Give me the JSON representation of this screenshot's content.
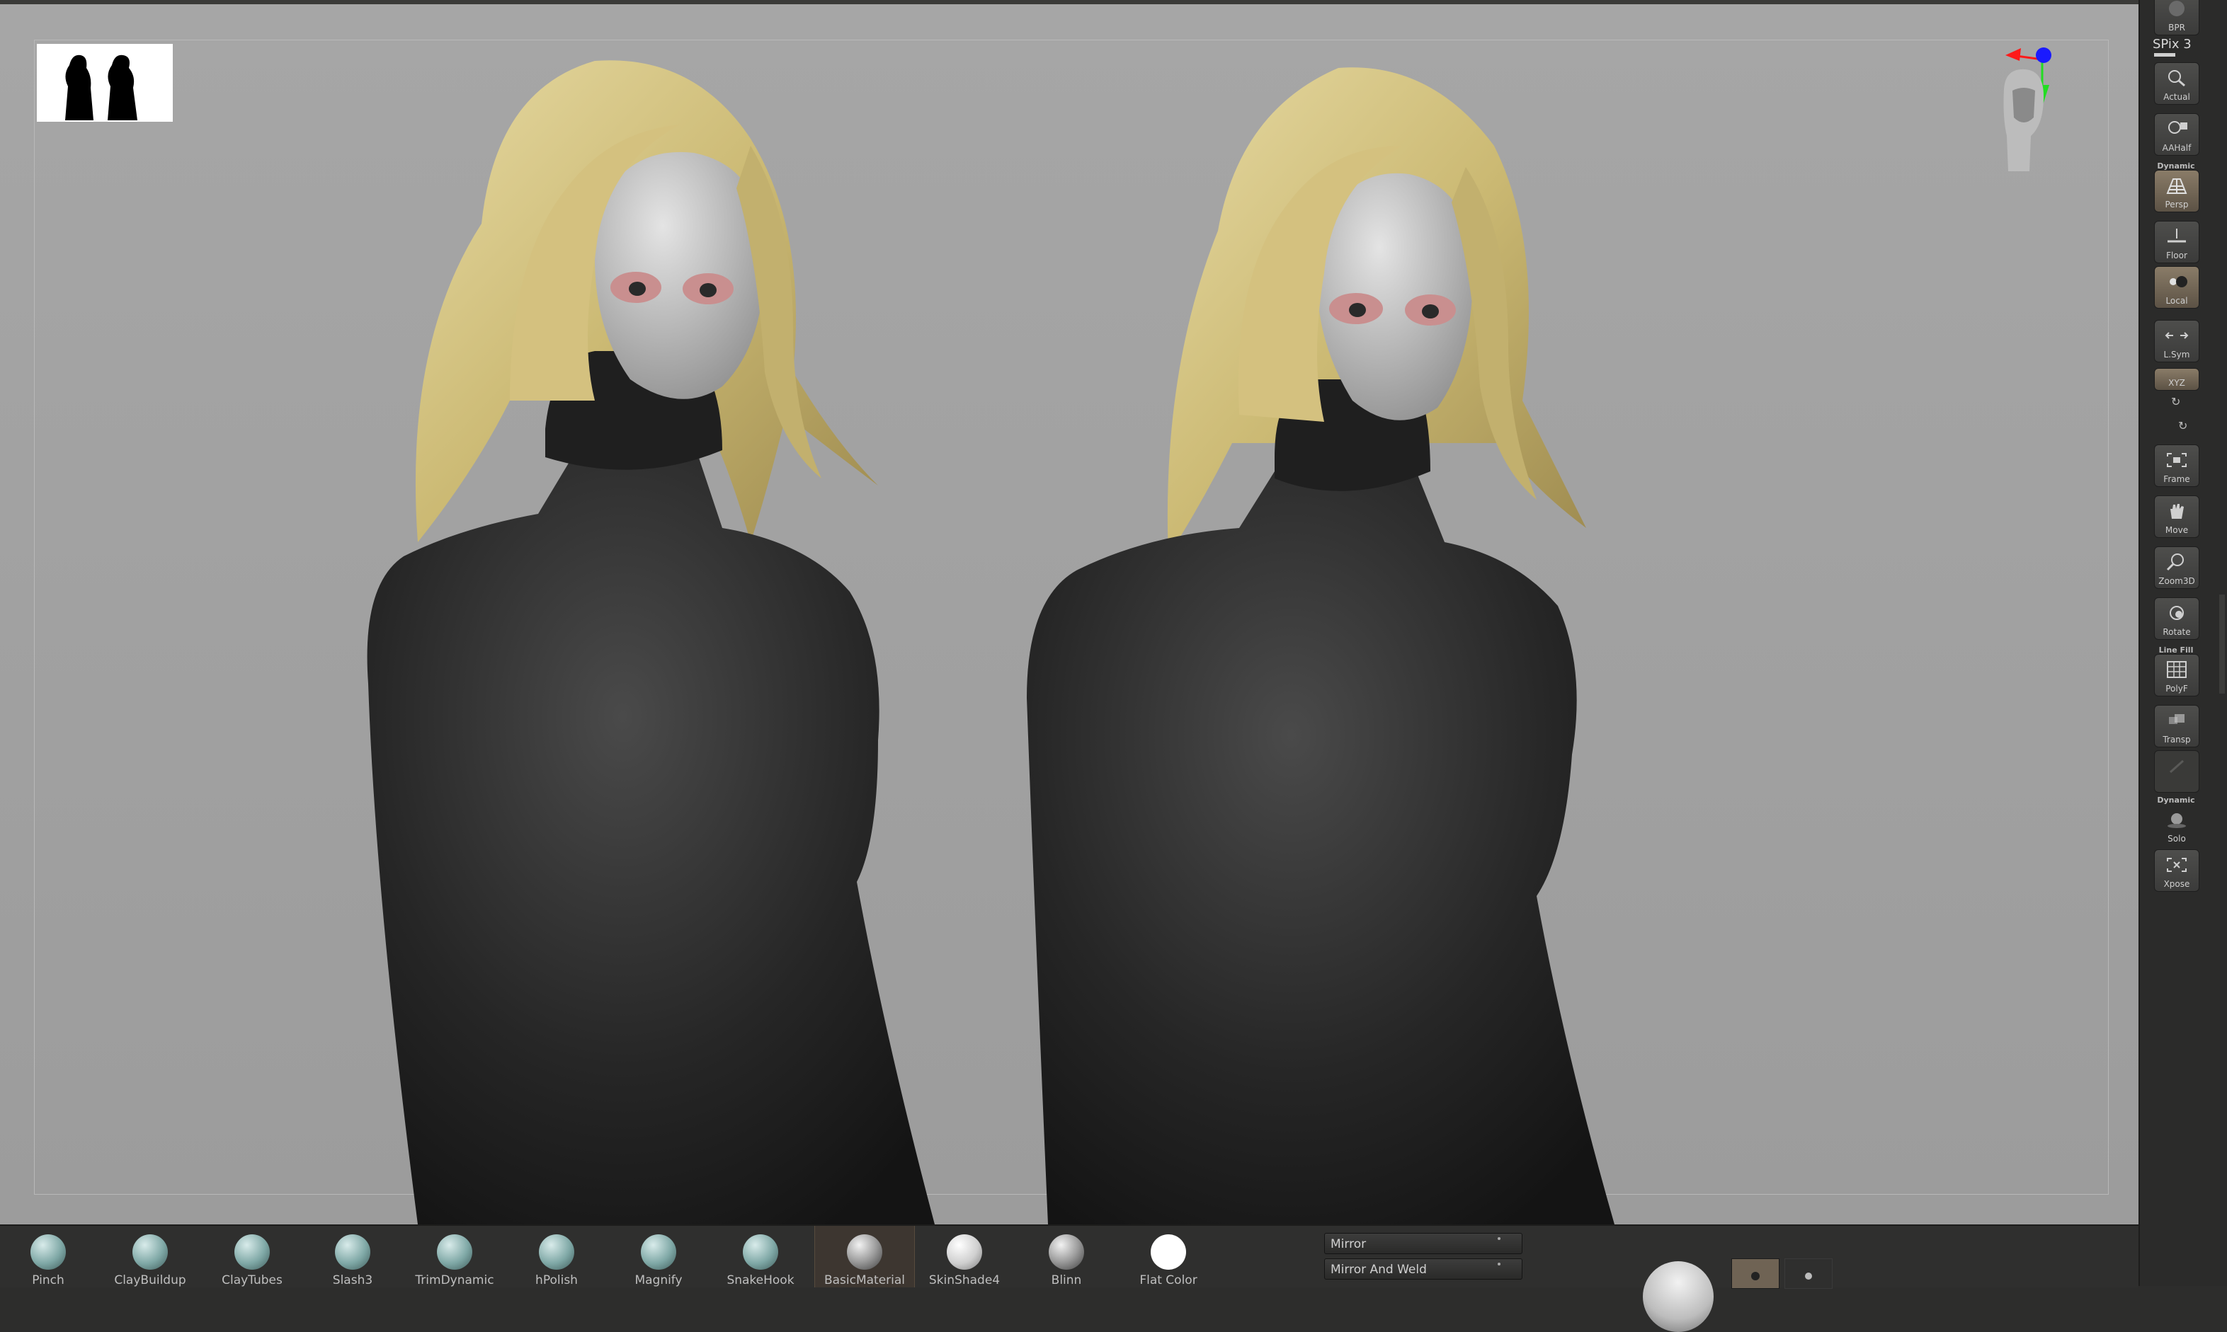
{
  "viewport": {
    "background": "#a3a3a3"
  },
  "right_shelf": {
    "spix_label": "SPix 3",
    "buttons": [
      {
        "id": "bpr",
        "label": "BPR",
        "icon": "bpr-icon"
      },
      {
        "id": "actual",
        "label": "Actual",
        "icon": "magnifier-icon"
      },
      {
        "id": "aahalf",
        "label": "AAHalf",
        "icon": "magnifier-half-icon"
      },
      {
        "id": "persp",
        "label": "Persp",
        "header": "Dynamic",
        "icon": "perspective-grid-icon",
        "active": true
      },
      {
        "id": "floor",
        "label": "Floor",
        "icon": "floor-icon"
      },
      {
        "id": "local",
        "label": "Local",
        "icon": "local-icon",
        "active": true
      },
      {
        "id": "lsym",
        "label": "L.Sym",
        "icon": "symmetry-icon"
      },
      {
        "id": "xyz",
        "label": "XYZ",
        "icon": "xyz-icon",
        "active": true
      },
      {
        "id": "frame",
        "label": "Frame",
        "icon": "frame-icon"
      },
      {
        "id": "move",
        "label": "Move",
        "icon": "hand-icon"
      },
      {
        "id": "zoom3d",
        "label": "Zoom3D",
        "icon": "zoom3d-icon"
      },
      {
        "id": "rotate",
        "label": "Rotate",
        "icon": "rotate-icon"
      },
      {
        "id": "polyf",
        "label": "PolyF",
        "header": "Line Fill",
        "icon": "polyframe-icon"
      },
      {
        "id": "transp",
        "label": "Transp",
        "icon": "transparency-icon"
      },
      {
        "id": "ghost",
        "label": "",
        "icon": "ghost-icon"
      },
      {
        "id": "solo",
        "label": "Solo",
        "header": "Dynamic",
        "icon": "solo-icon"
      },
      {
        "id": "xpose",
        "label": "Xpose",
        "icon": "xpose-icon"
      }
    ]
  },
  "bottom_shelf": {
    "brushes": [
      {
        "label": "Pinch",
        "icon": "pinch-brush-icon",
        "style": "s-teal"
      },
      {
        "label": "ClayBuildup",
        "icon": "claybuildup-brush-icon",
        "style": "s-teal"
      },
      {
        "label": "ClayTubes",
        "icon": "claytubes-brush-icon",
        "style": "s-teal"
      },
      {
        "label": "Slash3",
        "icon": "slash3-brush-icon",
        "style": "s-teal"
      },
      {
        "label": "TrimDynamic",
        "icon": "trimdynamic-brush-icon",
        "style": "s-teal"
      },
      {
        "label": "hPolish",
        "icon": "hpolish-brush-icon",
        "style": "s-teal"
      },
      {
        "label": "Magnify",
        "icon": "magnify-brush-icon",
        "style": "s-teal"
      },
      {
        "label": "SnakeHook",
        "icon": "snakehook-brush-icon",
        "style": "s-teal"
      }
    ],
    "materials": [
      {
        "label": "BasicMaterial",
        "icon": "basicmaterial-sphere-icon",
        "style": "s-grey",
        "selected": true
      },
      {
        "label": "SkinShade4",
        "icon": "skinshade4-sphere-icon",
        "style": "s-white"
      },
      {
        "label": "Blinn",
        "icon": "blinn-sphere-icon",
        "style": "s-grey"
      },
      {
        "label": "Flat Color",
        "icon": "flatcolor-sphere-icon",
        "style": "s-flat"
      }
    ],
    "mirror_label": "Mirror",
    "mirror_weld_label": "Mirror And Weld"
  }
}
